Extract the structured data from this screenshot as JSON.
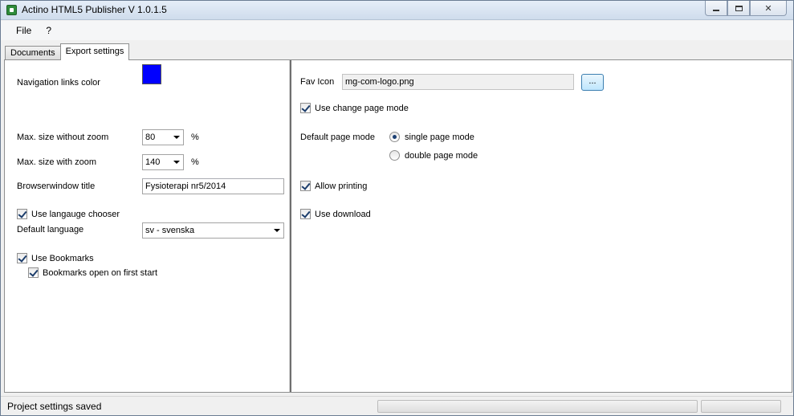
{
  "window": {
    "title": "Actino HTML5 Publisher V 1.0.1.5"
  },
  "menu": {
    "items": [
      "File",
      "?"
    ]
  },
  "tabs": [
    {
      "label": "Documents",
      "active": false
    },
    {
      "label": "Export settings",
      "active": true
    }
  ],
  "left": {
    "nav_color_label": "Navigation links color",
    "nav_color": "#0000ff",
    "max_no_zoom_label": "Max. size without zoom",
    "max_no_zoom_value": "80",
    "max_zoom_label": "Max. size with zoom",
    "max_zoom_value": "140",
    "percent": "%",
    "browser_title_label": "Browserwindow title",
    "browser_title_value": "Fysioterapi nr5/2014",
    "use_lang_chooser_label": "Use langauge chooser",
    "use_lang_chooser_checked": true,
    "default_lang_label": "Default language",
    "default_lang_value": "sv - svenska",
    "use_bookmarks_label": "Use Bookmarks",
    "use_bookmarks_checked": true,
    "bookmarks_open_label": "Bookmarks open on first start",
    "bookmarks_open_checked": true
  },
  "right": {
    "fav_icon_label": "Fav Icon",
    "fav_icon_value": "mg-com-logo.png",
    "browse_label": "...",
    "change_page_label": "Use change page mode",
    "change_page_checked": true,
    "default_page_mode_label": "Default page mode",
    "single_page_label": "single page mode",
    "double_page_label": "double page mode",
    "selected_page_mode": "single",
    "allow_printing_label": "Allow printing",
    "allow_printing_checked": true,
    "use_download_label": "Use download",
    "use_download_checked": true
  },
  "status": {
    "text": "Project settings saved",
    "progress": 0
  }
}
